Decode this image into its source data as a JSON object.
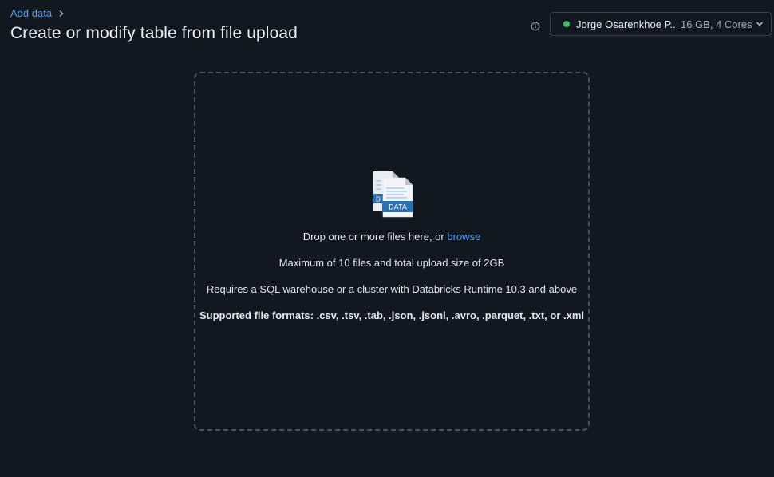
{
  "breadcrumb": {
    "parent_label": "Add data"
  },
  "page": {
    "title": "Create or modify table from file upload"
  },
  "compute": {
    "name": "Jorge Osarenkhoe P...",
    "spec": "16 GB, 4 Cores",
    "status": "running",
    "status_color": "#3fbd6b"
  },
  "dropzone": {
    "drop_text": "Drop one or more files here, or",
    "browse_label": "browse",
    "limit_text": "Maximum of 10 files and total upload size of 2GB",
    "requirement_text": "Requires a SQL warehouse or a cluster with Databricks Runtime 10.3 and above",
    "formats_text": "Supported file formats: .csv, .tsv, .tab, .json, .jsonl, .avro, .parquet, .txt, or .xml",
    "icon_label": "DATA"
  },
  "colors": {
    "background": "#121820",
    "link": "#4f9ef0",
    "accent": "#2c6fb0"
  },
  "icons": [
    "chevron-right-icon",
    "info-icon",
    "chevron-down-icon",
    "data-files-icon"
  ]
}
